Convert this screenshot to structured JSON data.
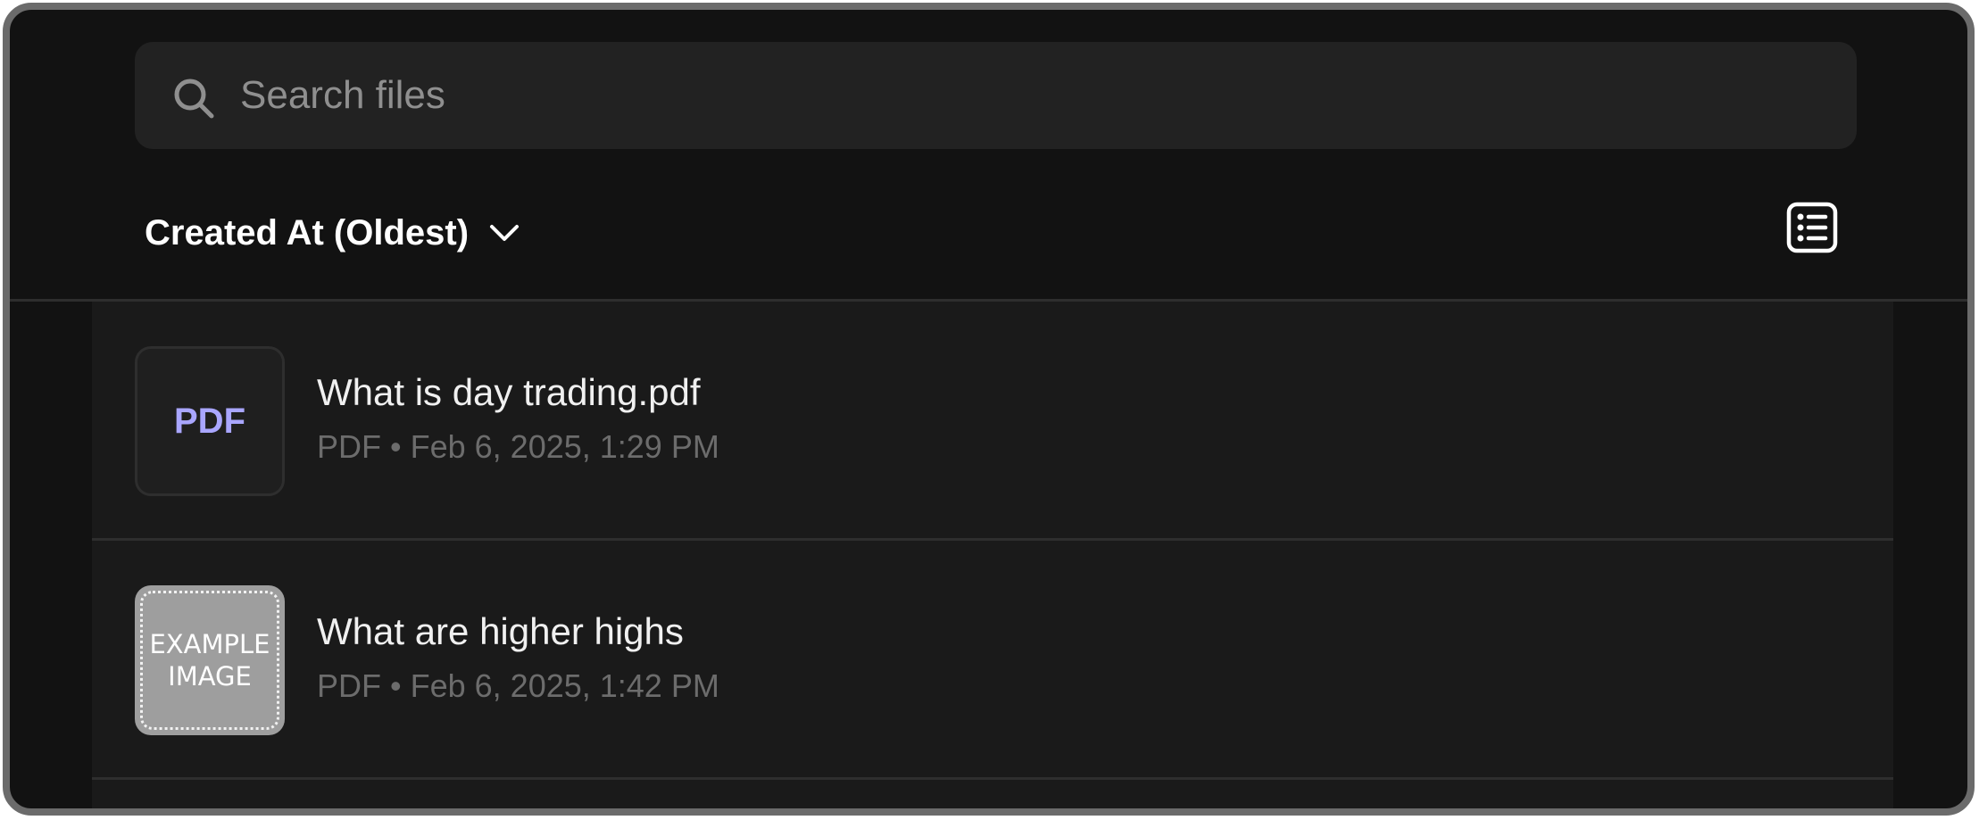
{
  "search": {
    "placeholder": "Search files",
    "value": ""
  },
  "sort": {
    "label": "Created At (Oldest)"
  },
  "view_toggle": {
    "icon": "list-view-icon"
  },
  "files": [
    {
      "name": "What is day trading.pdf",
      "meta": "PDF • Feb 6, 2025, 1:29 PM",
      "thumbnail_type": "pdf",
      "thumbnail_text": "PDF"
    },
    {
      "name": "What are higher highs",
      "meta": "PDF • Feb 6, 2025, 1:42 PM",
      "thumbnail_type": "image",
      "thumbnail_text": "EXAMPLE\nIMAGE"
    }
  ],
  "colors": {
    "background": "#121212",
    "list_background": "#1a1a1a",
    "search_background": "#222222",
    "pdf_accent": "#a9a6ff",
    "meta_text": "#6c6c6c"
  }
}
